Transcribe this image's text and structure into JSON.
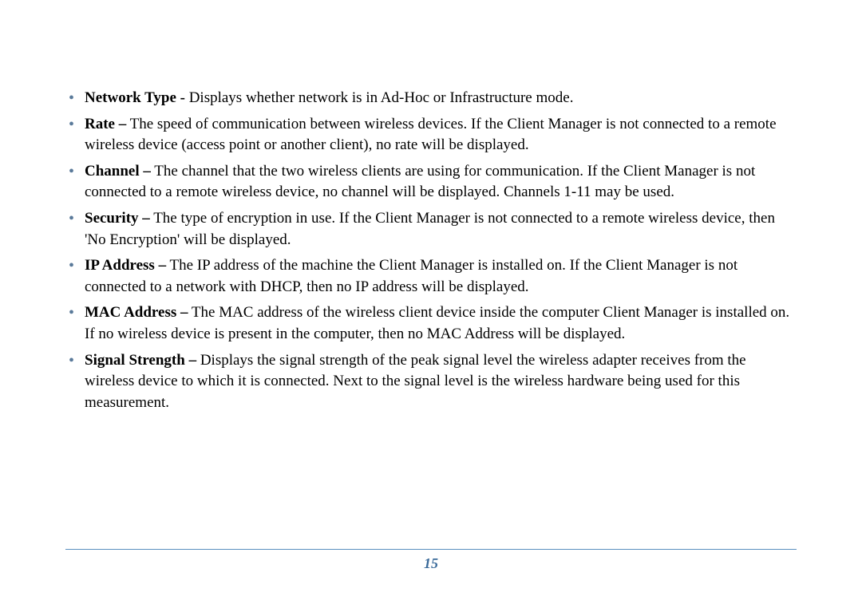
{
  "items": [
    {
      "term": "Network Type -",
      "desc": " Displays whether network is in Ad-Hoc or Infrastructure mode."
    },
    {
      "term": "Rate –",
      "desc": " The speed of communication between wireless devices.  If the Client Manager is not connected to a remote wireless device (access point or another client), no rate will be displayed."
    },
    {
      "term": "Channel –",
      "desc": " The channel that the two wireless clients are using for communication.  If the Client Manager is not connected to a remote wireless device, no channel will be displayed.  Channels 1-11 may be used."
    },
    {
      "term": "Security –",
      "desc": " The type of encryption in use.  If the Client Manager is not connected to a remote wireless device, then 'No Encryption' will be displayed."
    },
    {
      "term": "IP Address –",
      "desc": " The IP address of the machine the Client Manager is installed on. If the Client Manager is not connected to a network with DHCP, then no IP address will be displayed."
    },
    {
      "term": "MAC Address –",
      "desc": " The MAC address of the wireless client device inside the computer Client Manager is installed on. If no wireless device is present in the computer, then no MAC Address will be displayed."
    },
    {
      "term": "Signal Strength –",
      "desc": " Displays the signal strength of the peak signal level the wireless adapter receives from the wireless device to which it is connected.  Next to the signal level is the wireless hardware being used for this measurement."
    }
  ],
  "page_number": "15"
}
